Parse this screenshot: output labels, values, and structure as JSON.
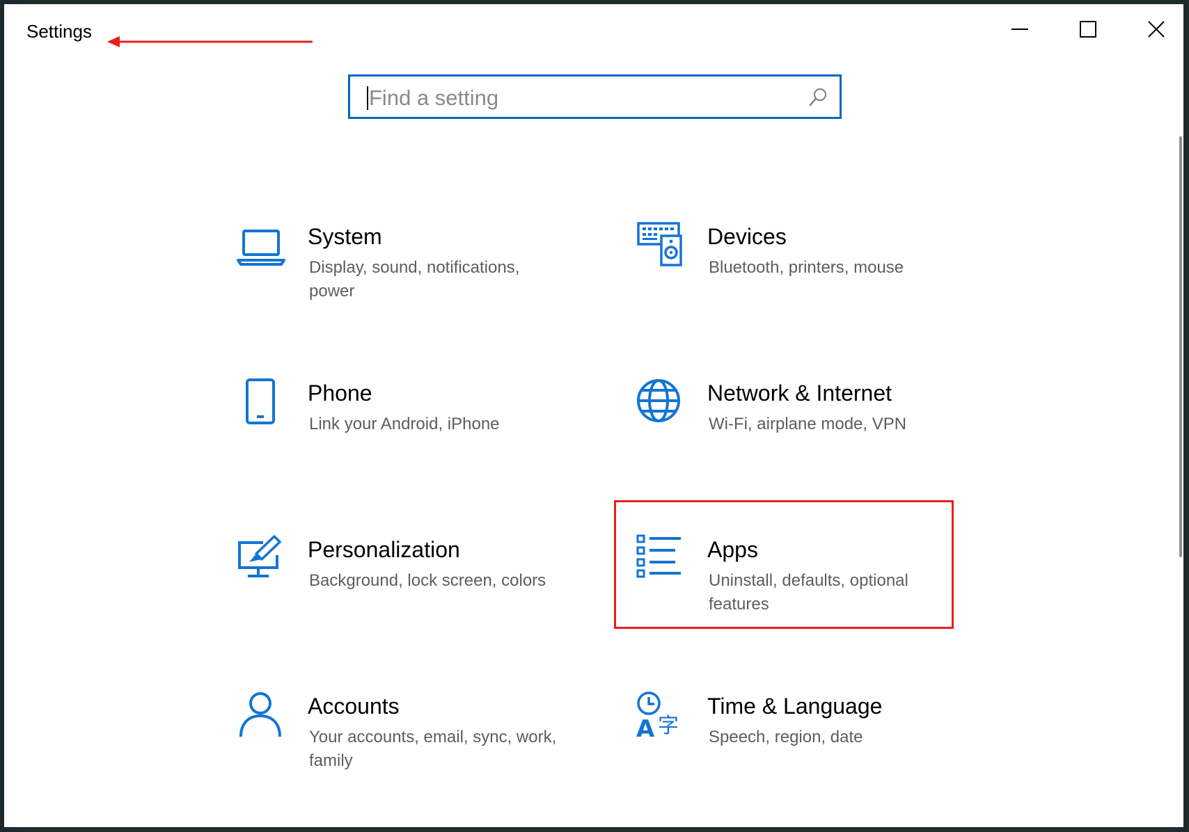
{
  "window": {
    "title": "Settings",
    "controls": {
      "minimize": "minimize-icon",
      "maximize": "maximize-icon",
      "close": "close-icon"
    }
  },
  "search": {
    "placeholder": "Find a setting",
    "icon": "search-icon"
  },
  "categories": [
    {
      "name": "System",
      "description": "Display, sound, notifications, power",
      "icon": "laptop-icon"
    },
    {
      "name": "Devices",
      "description": "Bluetooth, printers, mouse",
      "icon": "keyboard-speaker-icon"
    },
    {
      "name": "Phone",
      "description": "Link your Android, iPhone",
      "icon": "phone-icon"
    },
    {
      "name": "Network & Internet",
      "description": "Wi-Fi, airplane mode, VPN",
      "icon": "globe-icon"
    },
    {
      "name": "Personalization",
      "description": "Background, lock screen, colors",
      "icon": "paintbrush-monitor-icon"
    },
    {
      "name": "Apps",
      "description": "Uninstall, defaults, optional features",
      "icon": "app-list-icon"
    },
    {
      "name": "Accounts",
      "description": "Your accounts, email, sync, work, family",
      "icon": "person-icon"
    },
    {
      "name": "Time & Language",
      "description": "Speech, region, date",
      "icon": "clock-language-icon"
    }
  ],
  "annotations": {
    "title_arrow_color": "#e81e1e",
    "highlighted_category": "Apps",
    "highlight_color": "#e81e1e"
  },
  "colors": {
    "accent": "#0067c0",
    "icon_blue": "#1474d4"
  }
}
